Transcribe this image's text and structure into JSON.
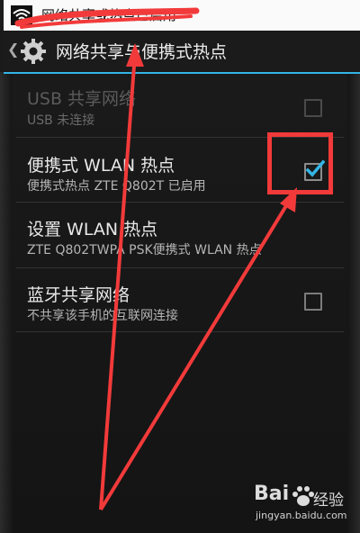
{
  "notification": {
    "text": "网络共享或热点已启用",
    "icon": "wifi-hotspot-icon"
  },
  "action_bar": {
    "back_glyph": "❮",
    "icon": "gear-icon",
    "title": "网络共享与便携式热点"
  },
  "list": {
    "items": [
      {
        "title": "USB 共享网络",
        "summary": "USB 未连接",
        "checked": false,
        "enabled": false
      },
      {
        "title": "便携式 WLAN 热点",
        "summary": "便携式热点 ZTE Q802T 已启用",
        "checked": true,
        "enabled": true
      },
      {
        "title": "设置 WLAN 热点",
        "summary": "ZTE Q802TWPA PSK便携式 WLAN 热点"
      },
      {
        "title": "蓝牙共享网络",
        "summary": "不共享该手机的互联网连接",
        "checked": false,
        "enabled": true
      }
    ]
  },
  "colors": {
    "accent": "#33b5e5",
    "annotation": "#f23a3a"
  },
  "watermark": {
    "brand": "Bai",
    "brand_cn": "经验",
    "url": "jingyan.baidu.com"
  }
}
